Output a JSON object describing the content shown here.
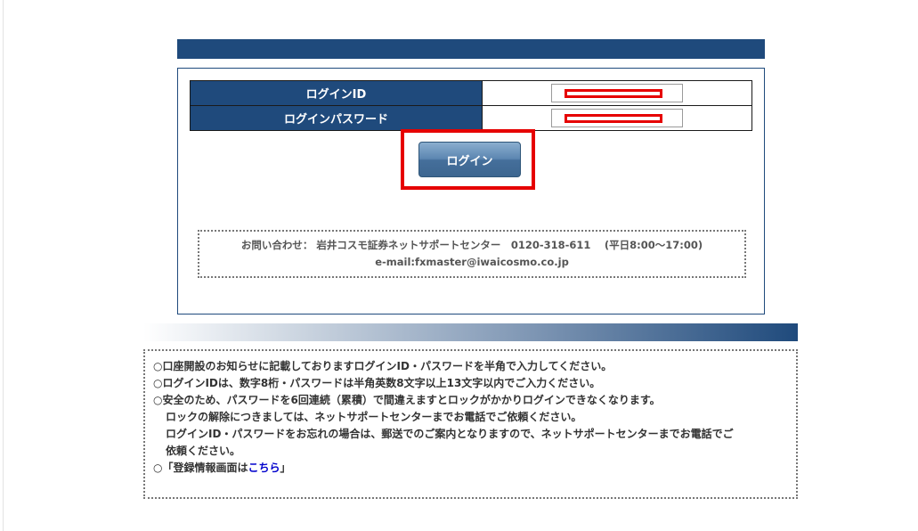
{
  "login_form": {
    "id_label": "ログインID",
    "password_label": "ログインパスワード",
    "id_value": "",
    "password_value": "",
    "login_button_label": "ログイン"
  },
  "contact": {
    "line1": "お問い合わせ： 岩井コスモ証券ネットサポートセンター　0120-318-611　 (平日8:00～17:00)",
    "line2": "e-mail:fxmaster@iwaicosmo.co.jp"
  },
  "notices": {
    "line1": "○口座開設のお知らせに記載しておりますログインID・パスワードを半角で入力してください。",
    "line2": "○ログインIDは、数字8桁・パスワードは半角英数8文字以上13文字以内でご入力ください。",
    "line3": "○安全のため、パスワードを6回連続（累積）で間違えますとロックがかかりログインできなくなります。",
    "line4": "ロックの解除につきましては、ネットサポートセンターまでお電話でご依頼ください。",
    "line5": "ログインID・パスワードをお忘れの場合は、郵送でのご案内となりますので、ネットサポートセンターまでお電話でご",
    "line6": "依頼ください。",
    "registration_prefix": "○「登録情報画面は",
    "registration_link": "こちら",
    "registration_suffix": "」"
  },
  "colors": {
    "navy": "#1f4a7c",
    "highlight_red": "#e60000",
    "link_blue": "#0000cc"
  }
}
